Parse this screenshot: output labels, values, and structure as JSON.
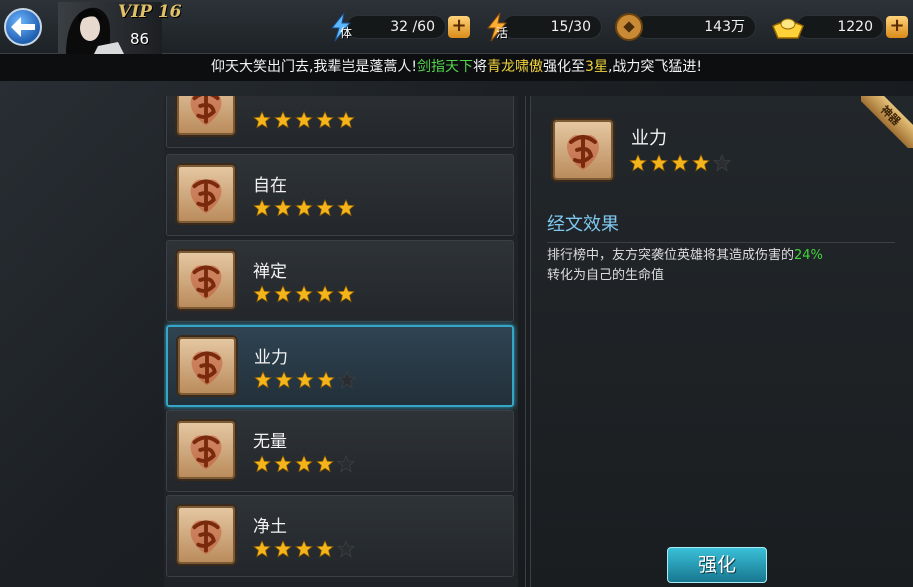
{
  "player": {
    "vip": "VIP 16",
    "level": "86"
  },
  "resources": [
    {
      "name": "stamina",
      "icon": "stamina-lightning-icon",
      "value": "32 /60",
      "glyph": "体",
      "has_plus": true
    },
    {
      "name": "energy",
      "icon": "energy-lightning-icon",
      "value": "15/30",
      "glyph": "活",
      "has_plus": false
    },
    {
      "name": "copper",
      "icon": "copper-coin-icon",
      "value": "143万",
      "has_plus": false
    },
    {
      "name": "gold",
      "icon": "gold-ingot-icon",
      "value": "1220",
      "has_plus": true
    }
  ],
  "banner": {
    "part1": "仰天大笑出门去,我辈岂是蓬蒿人!",
    "player_name": "剑指天下",
    "part2": "将",
    "item_name": "青龙啸傲",
    "part3": "强化至",
    "star_level": "3星",
    "part4": ",战力突飞猛进!"
  },
  "list": {
    "items": [
      {
        "name": "",
        "stars": 5,
        "max_stars": 5,
        "selected": false
      },
      {
        "name": "自在",
        "stars": 5,
        "max_stars": 5,
        "selected": false
      },
      {
        "name": "禅定",
        "stars": 5,
        "max_stars": 5,
        "selected": false
      },
      {
        "name": "业力",
        "stars": 4,
        "max_stars": 5,
        "selected": true
      },
      {
        "name": "无量",
        "stars": 4,
        "max_stars": 5,
        "selected": false
      },
      {
        "name": "净土",
        "stars": 4,
        "max_stars": 5,
        "selected": false
      }
    ]
  },
  "detail": {
    "corner_badge": "神器",
    "name": "业力",
    "stars": 4,
    "max_stars": 5,
    "section_title": "经文效果",
    "effect_line1_a": "排行榜中，友方突袭位英雄将其造成伤害的",
    "effect_pct": "24%",
    "effect_line2": "转化为自己的生命值",
    "upgrade_label": "强化"
  },
  "colors": {
    "accent": "#35a6c5",
    "star": "#f4b41c",
    "highlight_green": "#55d24d",
    "highlight_yellow": "#f0d23c"
  }
}
